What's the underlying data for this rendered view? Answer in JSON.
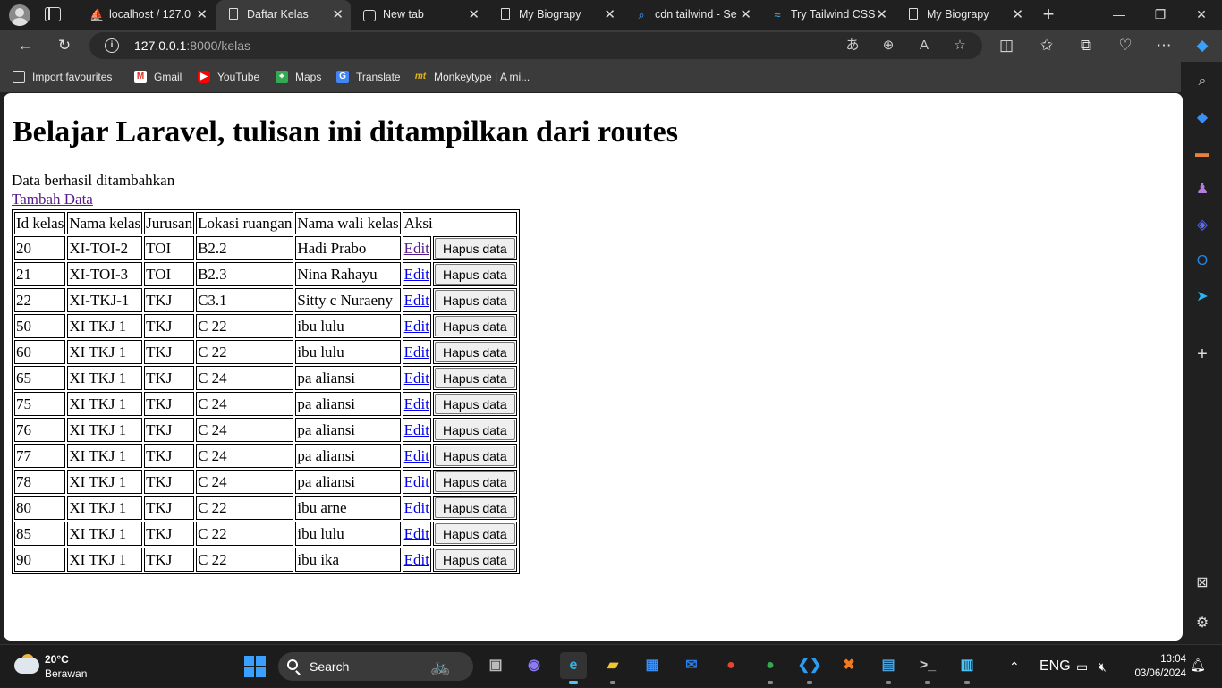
{
  "browser": {
    "tabs": [
      {
        "label": "localhost / 127.0",
        "icon": "phpmyadmin-icon"
      },
      {
        "label": "Daftar Kelas",
        "icon": "document-icon",
        "active": true
      },
      {
        "label": "New tab",
        "icon": "newtab-icon"
      },
      {
        "label": "My Biograpy",
        "icon": "document-icon"
      },
      {
        "label": "cdn tailwind - Se",
        "icon": "search-icon"
      },
      {
        "label": "Try Tailwind CSS",
        "icon": "tailwind-icon"
      },
      {
        "label": "My Biograpy",
        "icon": "document-icon"
      }
    ],
    "address": {
      "host": "127.0.0.1",
      "rest": ":8000/kelas"
    },
    "favourites": [
      {
        "label": "Import favourites",
        "icon": "import-icon"
      },
      {
        "label": "Gmail",
        "icon": "gmail-icon"
      },
      {
        "label": "YouTube",
        "icon": "youtube-icon"
      },
      {
        "label": "Maps",
        "icon": "maps-icon"
      },
      {
        "label": "Translate",
        "icon": "translate-icon"
      },
      {
        "label": "Monkeytype | A mi...",
        "icon": "monkeytype-icon"
      }
    ]
  },
  "page": {
    "heading": "Belajar Laravel, tulisan ini ditampilkan dari routes",
    "message": "Data berhasil ditambahkan",
    "add_link": "Tambah Data",
    "table": {
      "headers": [
        "Id kelas",
        "Nama kelas",
        "Jurusan",
        "Lokasi ruangan",
        "Nama wali kelas",
        "Aksi"
      ],
      "edit_label": "Edit",
      "delete_label": "Hapus data",
      "rows": [
        [
          "20",
          "XI-TOI-2",
          "TOI",
          "B2.2",
          "Hadi Prabo"
        ],
        [
          "21",
          "XI-TOI-3",
          "TOI",
          "B2.3",
          "Nina Rahayu"
        ],
        [
          "22",
          "XI-TKJ-1",
          "TKJ",
          "C3.1",
          "Sitty c Nuraeny"
        ],
        [
          "50",
          "XI TKJ 1",
          "TKJ",
          "C 22",
          "ibu lulu"
        ],
        [
          "60",
          "XI TKJ 1",
          "TKJ",
          "C 22",
          "ibu lulu"
        ],
        [
          "65",
          "XI TKJ 1",
          "TKJ",
          "C 24",
          "pa aliansi"
        ],
        [
          "75",
          "XI TKJ 1",
          "TKJ",
          "C 24",
          "pa aliansi"
        ],
        [
          "76",
          "XI TKJ 1",
          "TKJ",
          "C 24",
          "pa aliansi"
        ],
        [
          "77",
          "XI TKJ 1",
          "TKJ",
          "C 24",
          "pa aliansi"
        ],
        [
          "78",
          "XI TKJ 1",
          "TKJ",
          "C 24",
          "pa aliansi"
        ],
        [
          "80",
          "XI TKJ 1",
          "TKJ",
          "C 22",
          "ibu arne"
        ],
        [
          "85",
          "XI TKJ 1",
          "TKJ",
          "C 22",
          "ibu lulu"
        ],
        [
          "90",
          "XI TKJ 1",
          "TKJ",
          "C 22",
          "ibu ika"
        ]
      ]
    }
  },
  "taskbar": {
    "weather": {
      "temp": "20°C",
      "condition": "Berawan"
    },
    "search_label": "Search",
    "language": "ENG",
    "time": "13:04",
    "date": "03/06/2024"
  }
}
